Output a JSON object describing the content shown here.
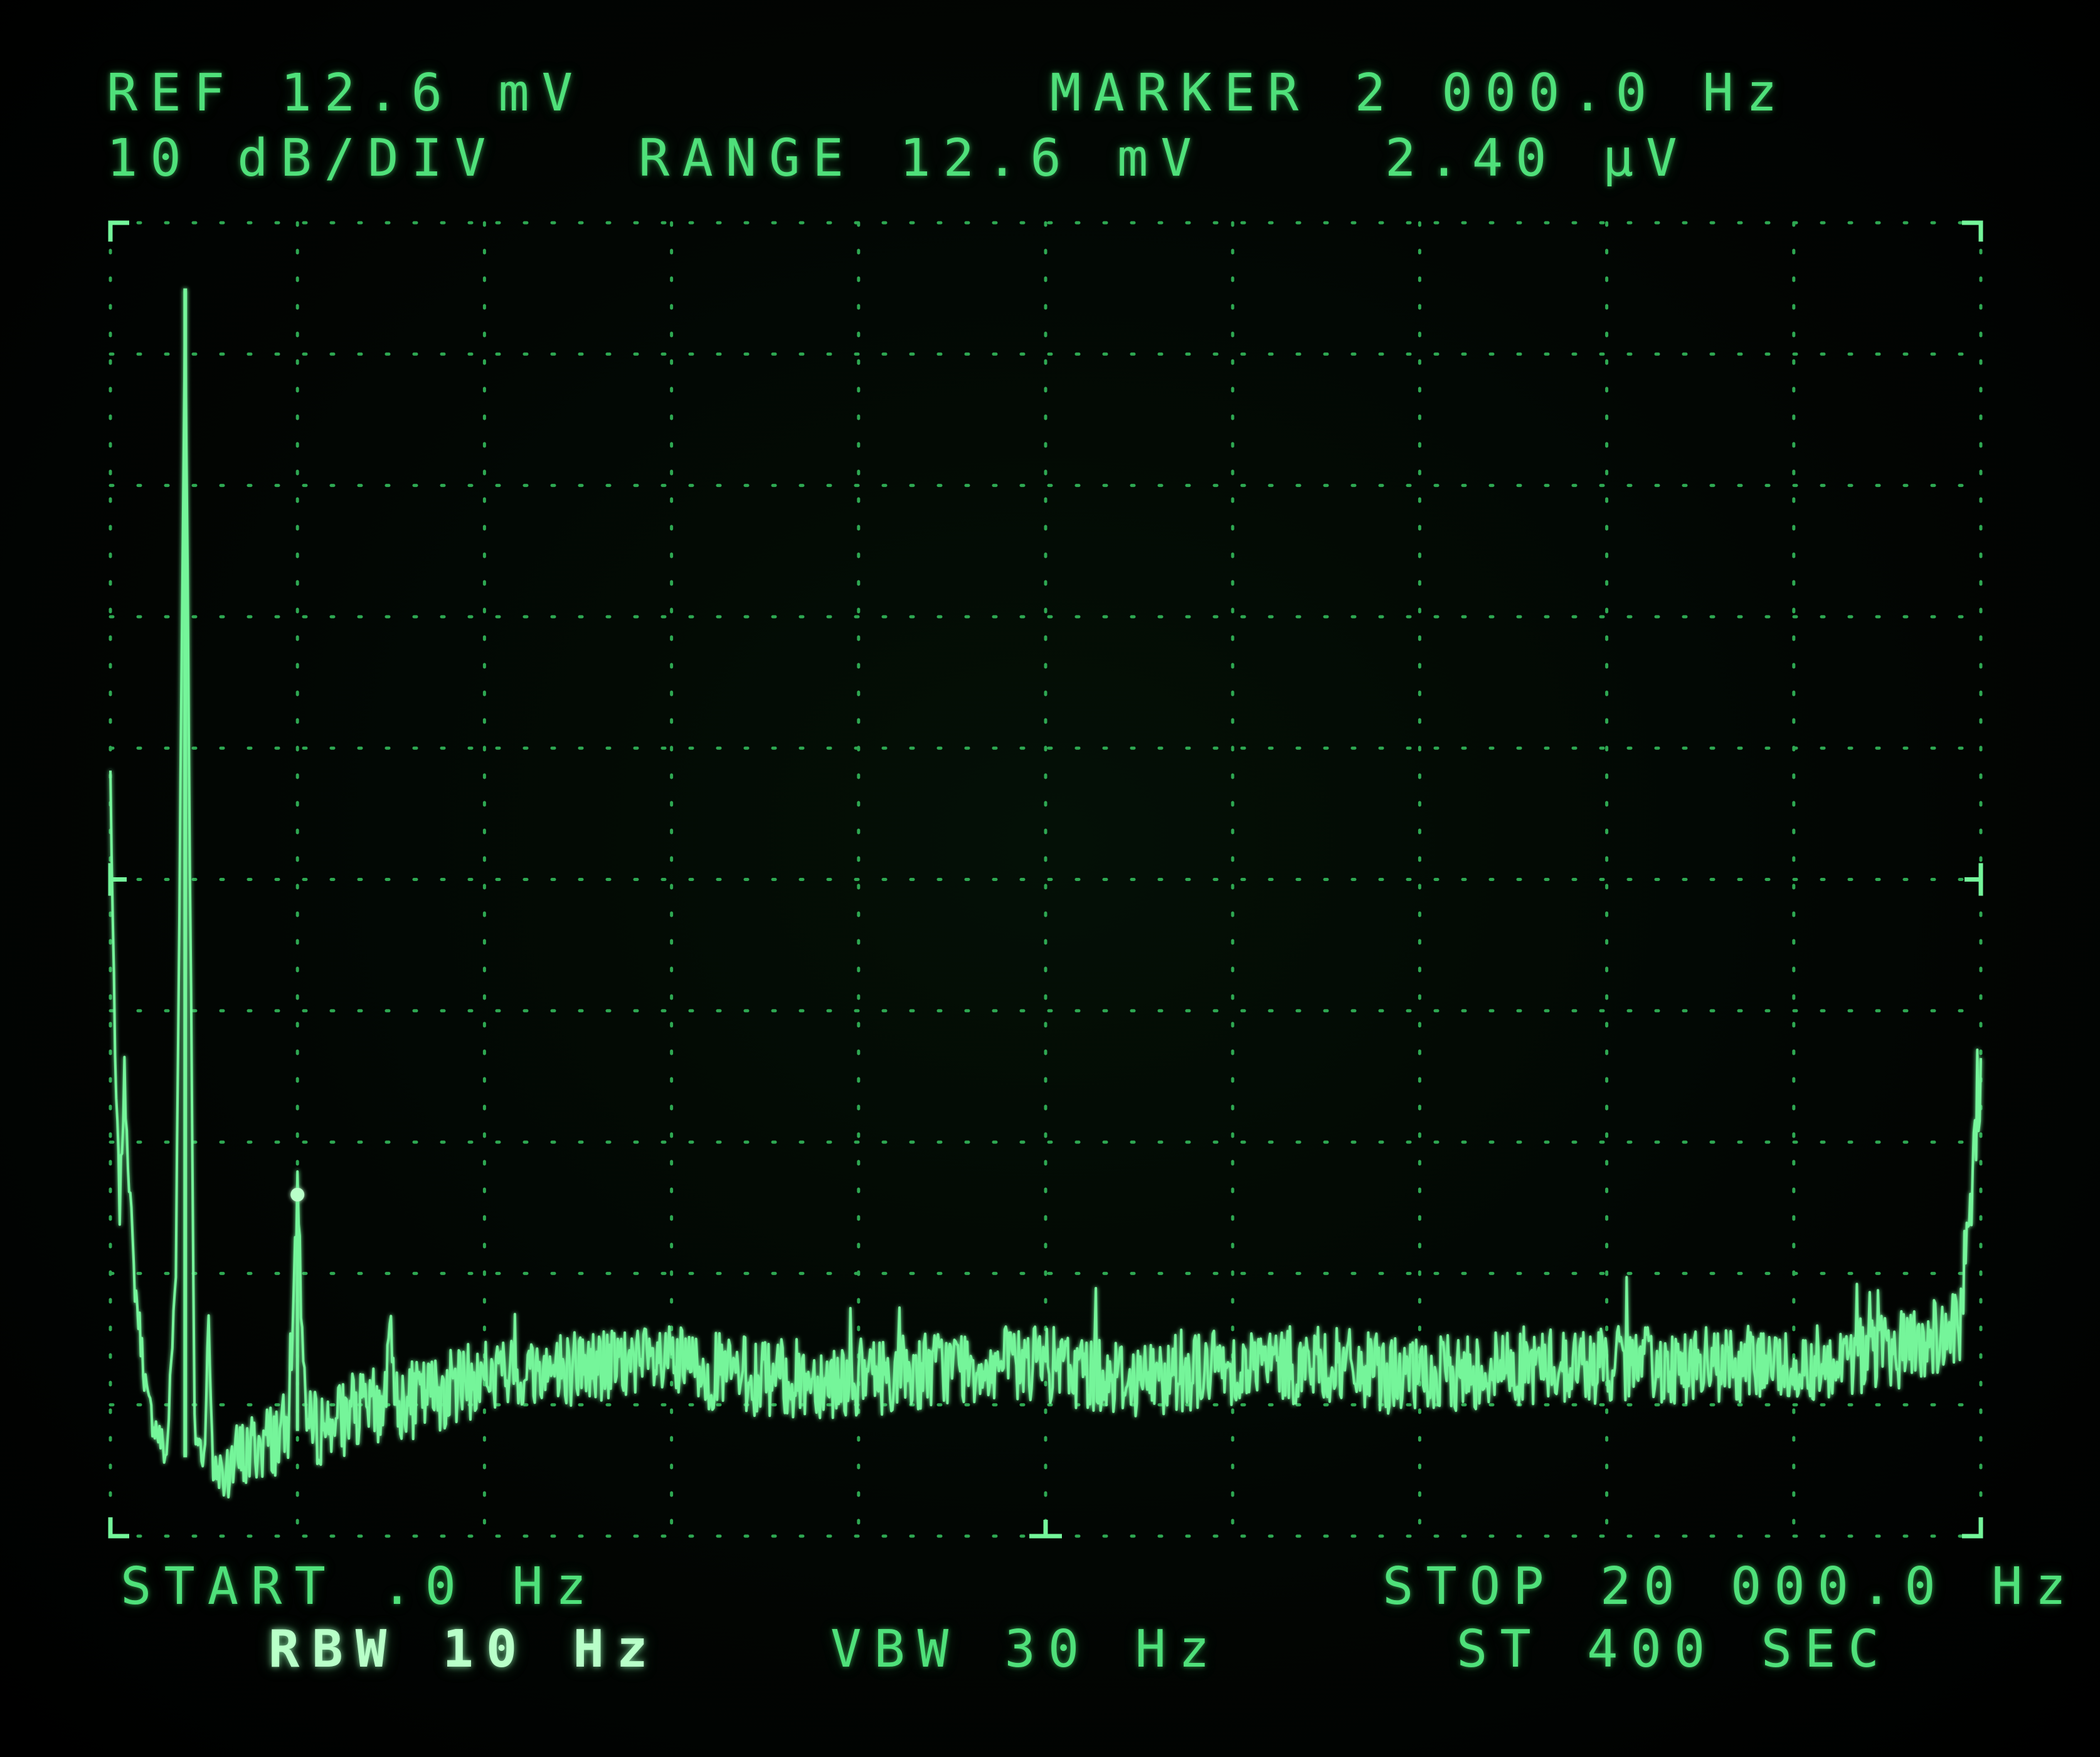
{
  "header": {
    "ref": "REF 12.6 mV",
    "scale": "10 dB/DIV",
    "range": "RANGE 12.6 mV",
    "marker_freq": "MARKER 2 000.0 Hz",
    "marker_level": "2.40 μV"
  },
  "footer": {
    "start": "START .0 Hz",
    "stop": "STOP 20 000.0 Hz",
    "rbw": "RBW 10 Hz",
    "vbw": "VBW 30 Hz",
    "sweep_time": "ST 400 SEC"
  },
  "colors": {
    "trace": "#74f59a",
    "graticule": "#2ea852",
    "text": "#4fe07a",
    "highlight": "#b8ffc8",
    "background": "#020603"
  },
  "chart_data": {
    "type": "line",
    "x_unit": "Hz",
    "y_unit": "dB relative to reference",
    "xlim": [
      0,
      20000
    ],
    "ylim": [
      -100,
      0
    ],
    "grid": true,
    "marker": {
      "x": 2000,
      "y": -74
    },
    "x": [
      0,
      50,
      100,
      150,
      250,
      400,
      600,
      700,
      800,
      900,
      1000,
      1050,
      1100,
      1200,
      1400,
      1600,
      1900,
      2000,
      2100,
      2500,
      2900,
      3000,
      3100,
      3500,
      4000,
      5000,
      6000,
      7000,
      8000,
      9000,
      10000,
      11000,
      12000,
      13000,
      14000,
      15000,
      16000,
      17000,
      18000,
      19000,
      19500,
      19800,
      19900,
      20000
    ],
    "y": [
      -42,
      -64,
      -75,
      -65,
      -80,
      -90,
      -94,
      -80,
      -5,
      -92,
      -94,
      -84,
      -95,
      -95,
      -94,
      -93,
      -92,
      -74,
      -92,
      -91,
      -90,
      -86,
      -90,
      -89,
      -88,
      -87,
      -87,
      -88,
      -88,
      -87,
      -87,
      -88,
      -87,
      -87,
      -88,
      -87,
      -87,
      -87,
      -87,
      -86,
      -85,
      -84,
      -74,
      -66
    ]
  }
}
